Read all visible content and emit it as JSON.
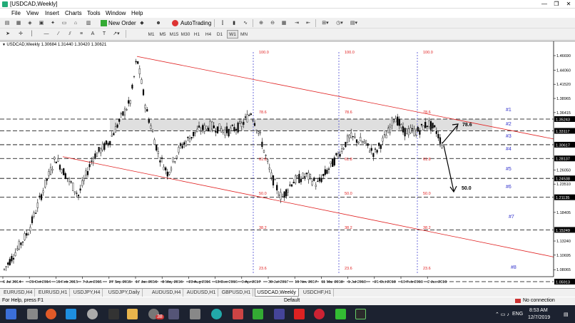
{
  "window": {
    "title": "[USDCAD,Weekly]",
    "controls": [
      "—",
      "❐",
      "✕"
    ]
  },
  "menu": [
    "File",
    "View",
    "Insert",
    "Charts",
    "Tools",
    "Window",
    "Help"
  ],
  "toolbar": {
    "new_order": "New Order",
    "autotrading": "AutoTrading",
    "timeframes": [
      "M1",
      "M5",
      "M15",
      "M30",
      "H1",
      "H4",
      "D1",
      "W1",
      "MN"
    ],
    "active_timeframe": "W1"
  },
  "chart": {
    "header": "USDCAD,Weekly  1.30684 1.31440 1.30420 1.30621",
    "symbol": "USDCAD",
    "period": "Weekly",
    "colors": {
      "channel": "#e02020",
      "candles": "#000000",
      "fib_lines": "#3333cc",
      "fib_labels": "#e02020",
      "zone": "#d4d4d4",
      "arrow": "#000000"
    },
    "price_labels": [
      "1.46690",
      "1.44060",
      "1.41520",
      "1.38965",
      "1.36415",
      "1.33790",
      "1.31240",
      "1.28690",
      "1.26050",
      "1.23510",
      "1.20960",
      "1.18405",
      "1.15855",
      "1.13240",
      "1.10695",
      "1.08065"
    ],
    "highlight_prices": [
      "1.35243",
      "1.33117",
      "1.30617",
      "1.28137",
      "1.24538",
      "1.21135",
      "1.15249",
      "1.05913"
    ],
    "dates": [
      "6 Jul 2014",
      "26 Oct 2014",
      "15 Feb 2015",
      "7 Jun 2015",
      "27 Sep 2015",
      "17 Jan 2016",
      "8 May 2016",
      "28 Aug 2016",
      "18 Dec 2016",
      "9 Apr 2017",
      "30 Jul 2017",
      "19 Nov 2017",
      "11 Mar 2018",
      "1 Jul 2018",
      "21 Oct 2018",
      "10 Feb 2019",
      "2 Jun 2019"
    ],
    "levels": [
      "#1",
      "#2",
      "#3",
      "#4",
      "#5",
      "#6",
      "#7",
      "#8"
    ],
    "fib_sets": [
      [
        "100.0",
        "78.6",
        "61.8",
        "50.0",
        "38.2",
        "23.6"
      ],
      [
        "100.0",
        "78.6",
        "61.8",
        "50.0",
        "38.2",
        "23.6"
      ],
      [
        "100.0",
        "78.6",
        "61.8",
        "50.0",
        "38.2",
        "23.6"
      ]
    ],
    "annotations": {
      "upper_target": "78.6",
      "lower_target": "50.0"
    }
  },
  "tabs": [
    "EURUSD,H4",
    "EURUSD,H1",
    "USDJPY,H4",
    "USDJPY,Daily",
    "AUDUSD,H4",
    "AUDUSD,H1",
    "GBPUSD,H1",
    "USDCAD,Weekly",
    "USDCHF,H1"
  ],
  "active_tab": "USDCAD,Weekly",
  "status": {
    "help": "For Help, press F1",
    "profile": "Default",
    "connection": "No connection"
  },
  "taskbar": {
    "language": "ENG",
    "time": "8:53 AM",
    "date": "12/7/2019",
    "badge": "38"
  }
}
